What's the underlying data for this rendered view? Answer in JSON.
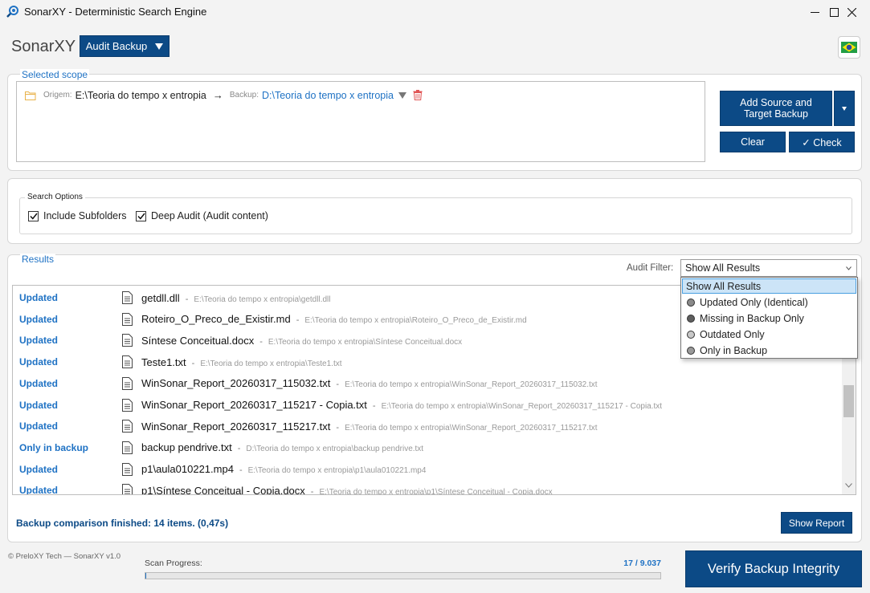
{
  "window": {
    "title": "SonarXY - Deterministic Search Engine"
  },
  "header": {
    "app_name": "SonarXY",
    "mode_button": "Audit Backup",
    "flag_icon": "brazil-flag-icon"
  },
  "scope": {
    "label": "Selected scope",
    "origin_label": "Origem:",
    "origin_path": "E:\\Teoria do tempo x entropia",
    "arrow": "→",
    "backup_label": "Backup:",
    "backup_path": "D:\\Teoria do tempo x entropia",
    "add_button": "Add Source and Target Backup",
    "clear_button": "Clear",
    "check_button": "✓ Check"
  },
  "search_options": {
    "label": "Search Options",
    "include_subfolders": {
      "label": "Include Subfolders",
      "checked": true
    },
    "deep_audit": {
      "label": "Deep Audit (Audit content)",
      "checked": true
    }
  },
  "results": {
    "label": "Results",
    "filter_label": "Audit Filter:",
    "filter_value": "Show All Results",
    "filter_options": [
      {
        "label": "Show All Results",
        "selected": true,
        "dot_color": ""
      },
      {
        "label": "Updated Only (Identical)",
        "selected": false,
        "dot_color": "#8a8a8a"
      },
      {
        "label": "Missing in Backup Only",
        "selected": false,
        "dot_color": "#5e5e5e"
      },
      {
        "label": "Outdated Only",
        "selected": false,
        "dot_color": "#c8c8c8"
      },
      {
        "label": "Only in Backup",
        "selected": false,
        "dot_color": "#9a9a9a"
      }
    ],
    "rows": [
      {
        "status": "Updated",
        "name": "getdll.dll",
        "path": "E:\\Teoria do tempo x entropia\\getdll.dll"
      },
      {
        "status": "Updated",
        "name": "Roteiro_O_Preco_de_Existir.md",
        "path": "E:\\Teoria do tempo x entropia\\Roteiro_O_Preco_de_Existir.md"
      },
      {
        "status": "Updated",
        "name": "Síntese Conceitual.docx",
        "path": "E:\\Teoria do tempo x entropia\\Síntese Conceitual.docx"
      },
      {
        "status": "Updated",
        "name": "Teste1.txt",
        "path": "E:\\Teoria do tempo x entropia\\Teste1.txt"
      },
      {
        "status": "Updated",
        "name": "WinSonar_Report_20260317_115032.txt",
        "path": "E:\\Teoria do tempo x entropia\\WinSonar_Report_20260317_115032.txt"
      },
      {
        "status": "Updated",
        "name": "WinSonar_Report_20260317_115217 - Copia.txt",
        "path": "E:\\Teoria do tempo x entropia\\WinSonar_Report_20260317_115217 - Copia.txt"
      },
      {
        "status": "Updated",
        "name": "WinSonar_Report_20260317_115217.txt",
        "path": "E:\\Teoria do tempo x entropia\\WinSonar_Report_20260317_115217.txt"
      },
      {
        "status": "Only in backup",
        "name": "backup pendrive.txt",
        "path": "D:\\Teoria do tempo x entropia\\backup pendrive.txt"
      },
      {
        "status": "Updated",
        "name": "p1\\aula010221.mp4",
        "path": "E:\\Teoria do tempo x entropia\\p1\\aula010221.mp4"
      },
      {
        "status": "Updated",
        "name": "p1\\Síntese Conceitual - Copia.docx",
        "path": "E:\\Teoria do tempo x entropia\\p1\\Síntese Conceitual - Copia.docx"
      }
    ],
    "separator": "-",
    "summary": "Backup comparison finished: 14 items. (0,47s)",
    "show_report_button": "Show Report"
  },
  "footer": {
    "copyright": "© PreloXY Tech — SonarXY v1.0",
    "progress_label": "Scan Progress:",
    "progress_count": "17 / 9.037",
    "progress_fraction": 0.0019,
    "verify_button": "Verify Backup Integrity"
  },
  "colors": {
    "accent": "#0c4a86",
    "link_blue": "#1f72c4",
    "delete_red": "#e05555",
    "folder_yellow": "#e8b24a"
  }
}
